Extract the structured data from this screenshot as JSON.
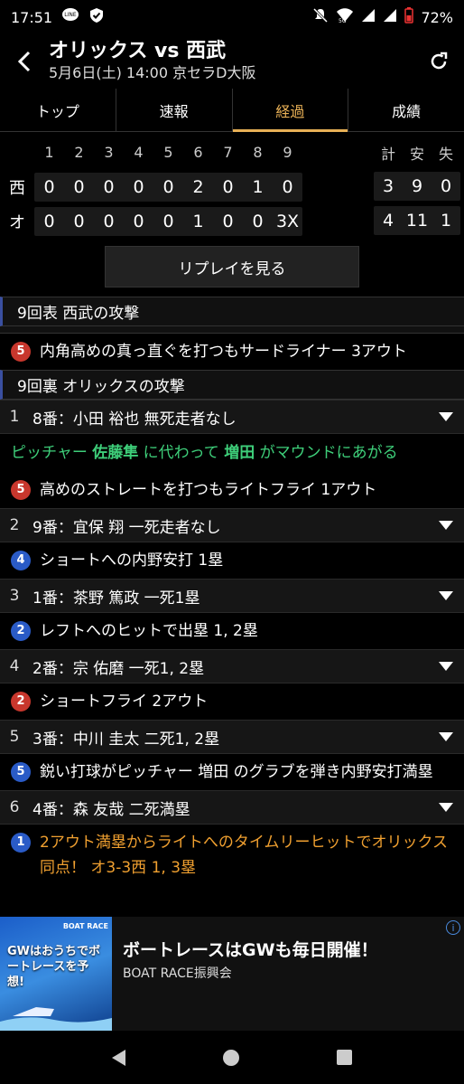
{
  "status": {
    "time": "17:51",
    "line_icon": "LINE",
    "battery": "72%",
    "network": "5G"
  },
  "header": {
    "title": "オリックス vs 西武",
    "subtitle": "5月6日(土) 14:00 京セラD大阪"
  },
  "tabs": [
    {
      "label": "トップ",
      "active": false
    },
    {
      "label": "速報",
      "active": false
    },
    {
      "label": "経過",
      "active": true
    },
    {
      "label": "成績",
      "active": false
    }
  ],
  "scoreboard": {
    "innings": [
      "1",
      "2",
      "3",
      "4",
      "5",
      "6",
      "7",
      "8",
      "9"
    ],
    "rhe_headers": [
      "計",
      "安",
      "失"
    ],
    "teams": [
      {
        "name": "西",
        "scores": [
          "0",
          "0",
          "0",
          "0",
          "0",
          "2",
          "0",
          "1",
          "0"
        ],
        "rhe": [
          "3",
          "9",
          "0"
        ]
      },
      {
        "name": "オ",
        "scores": [
          "0",
          "0",
          "0",
          "0",
          "0",
          "1",
          "0",
          "0",
          "3X"
        ],
        "rhe": [
          "4",
          "11",
          "1"
        ]
      }
    ]
  },
  "replay_button": "リプレイを見る",
  "feed": {
    "top9_header": "9回表  西武の攻撃",
    "top9_event": {
      "ball": "5",
      "text": "内角高めの真っ直ぐを打つもサードライナー  3アウト"
    },
    "bottom9_header": "9回裏  オリックスの攻撃",
    "batters": [
      {
        "num": "1",
        "info": "8番：小田  裕也   無死走者なし"
      },
      {
        "num": "2",
        "info": "9番：宜保  翔   一死走者なし"
      },
      {
        "num": "3",
        "info": "1番：茶野  篤政   一死1塁"
      },
      {
        "num": "4",
        "info": "2番：宗  佑磨   一死1, 2塁"
      },
      {
        "num": "5",
        "info": "3番：中川  圭太   二死1, 2塁"
      },
      {
        "num": "6",
        "info": "4番：森  友哉   二死満塁"
      }
    ],
    "pitcher_change": {
      "pre": "ピッチャー ",
      "old": "佐藤隼",
      "mid": " に代わって ",
      "new": "増田",
      "post": " がマウンドにあがる"
    },
    "events": [
      {
        "ball": "5",
        "color": "red",
        "text": "高めのストレートを打つもライトフライ  1アウト"
      },
      {
        "ball": "4",
        "color": "blue",
        "text": "ショートへの内野安打  1塁"
      },
      {
        "ball": "2",
        "color": "blue",
        "text": "レフトへのヒットで出塁  1, 2塁"
      },
      {
        "ball": "2",
        "color": "red",
        "text": "ショートフライ  2アウト"
      },
      {
        "ball": "5",
        "color": "blue",
        "text": "鋭い打球がピッチャー  増田  のグラブを弾き内野安打満塁"
      },
      {
        "ball": "1",
        "color": "blue",
        "text": "2アウト満塁からライトへのタイムリーヒットでオリックス同点！  オ3-3西  1, 3塁"
      }
    ]
  },
  "ad": {
    "title": "ボートレースはGWも毎日開催！",
    "sponsor": "BOAT RACE振興会",
    "image_text": "GWはおうちでボートレースを予想!",
    "image_tag": "BOAT RACE"
  }
}
